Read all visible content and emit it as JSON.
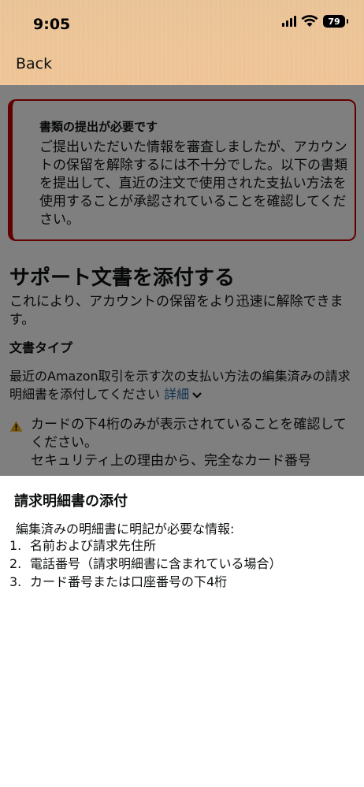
{
  "status_bar": {
    "time": "9:05",
    "battery": "79"
  },
  "nav": {
    "back_label": "Back"
  },
  "alert": {
    "title": "書類の提出が必要です",
    "body": "ご提出いただいた情報を審査しましたが、アカウントの保留を解除するには不十分でした。以下の書類を提出して、直近の注文で使用された支払い方法を使用することが承認されていることを確認してください。"
  },
  "section": {
    "title": "サポート文書を添付する",
    "description": "これにより、アカウントの保留をより迅速に解除できます。"
  },
  "doc_type": {
    "heading": "文書タイプ",
    "description": "最近のAmazon取引を示す次の支払い方法の編集済みの請求明細書を添付してください",
    "detail_link": "詳細"
  },
  "warning": {
    "line1": "カードの下4桁のみが表示されていることを確認してください。",
    "line2": "セキュリティ上の理由から、完全なカード番号"
  },
  "sheet": {
    "title": "請求明細書の添付",
    "intro": "編集済みの明細書に明記が必要な情報:",
    "items": [
      {
        "num": "1.",
        "text": "名前および請求先住所"
      },
      {
        "num": "2.",
        "text": "電話番号（請求明細書に含まれている場合）"
      },
      {
        "num": "3.",
        "text": "カード番号または口座番号の下4桁"
      }
    ]
  },
  "colors": {
    "header_bg": "#efc496",
    "alert_border": "#c40000",
    "link": "#2162a1",
    "warning": "#f0a80e"
  }
}
